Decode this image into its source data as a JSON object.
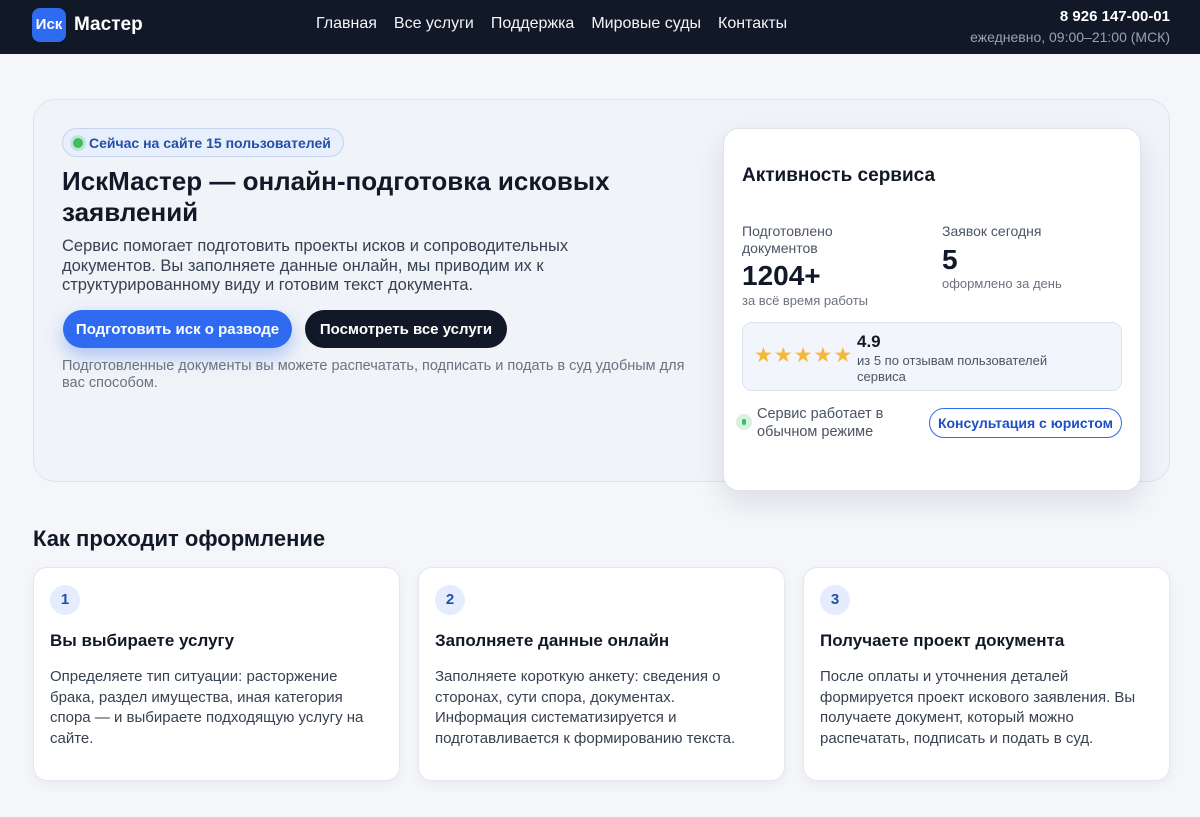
{
  "header": {
    "logo_mark": "Иск",
    "logo_text": "Мастер",
    "nav": [
      "Главная",
      "Все услуги",
      "Поддержка",
      "Мировые суды",
      "Контакты"
    ],
    "phone": "8 926 147-00-01",
    "hours": "ежедневно, 09:00–21:00 (МСК)"
  },
  "hero": {
    "online_badge": "Сейчас на сайте 15 пользователей",
    "title": "ИскМастер — онлайн-подготовка исковых заявлений",
    "description": "Сервис помогает подготовить проекты исков и сопроводительных документов. Вы заполняете данные онлайн, мы приводим их к структурированному виду и готовим текст документа.",
    "primary_button": "Подготовить иск о разводе",
    "secondary_button": "Посмотреть все услуги",
    "note": "Подготовленные документы вы можете распечатать, подписать и подать в суд удобным для вас способом."
  },
  "activity": {
    "title": "Активность сервиса",
    "documents_label": "Подготовлено документов",
    "documents_value": "1204+",
    "documents_sub": "за всё время работы",
    "today_label": "Заявок сегодня",
    "today_value": "5",
    "today_sub": "оформлено за день",
    "rating_value": "4.9",
    "rating_stars": 5,
    "rating_sub": "из 5 по отзывам пользователей сервиса",
    "status_text": "Сервис работает в обычном режиме",
    "consult_button": "Консультация с юристом"
  },
  "steps": {
    "title": "Как проходит оформление",
    "items": [
      {
        "number": "1",
        "title": "Вы выбираете услугу",
        "text": "Определяете тип ситуации: расторжение брака, раздел имущества, иная категория спора — и выбираете подходящую услугу на сайте."
      },
      {
        "number": "2",
        "title": "Заполняете данные онлайн",
        "text": "Заполняете короткую анкету: сведения о сторонах, сути спора, документах. Информация систематизируется и подготавливается к формированию текста."
      },
      {
        "number": "3",
        "title": "Получаете проект документа",
        "text": "После оплаты и уточнения деталей формируется проект искового заявления. Вы получаете документ, который можно распечатать, подписать и подать в суд."
      }
    ]
  },
  "colors": {
    "header_bg": "#111827",
    "accent": "#2f6bf0",
    "star": "#f4b93a",
    "online_green": "#3fbd5e"
  }
}
